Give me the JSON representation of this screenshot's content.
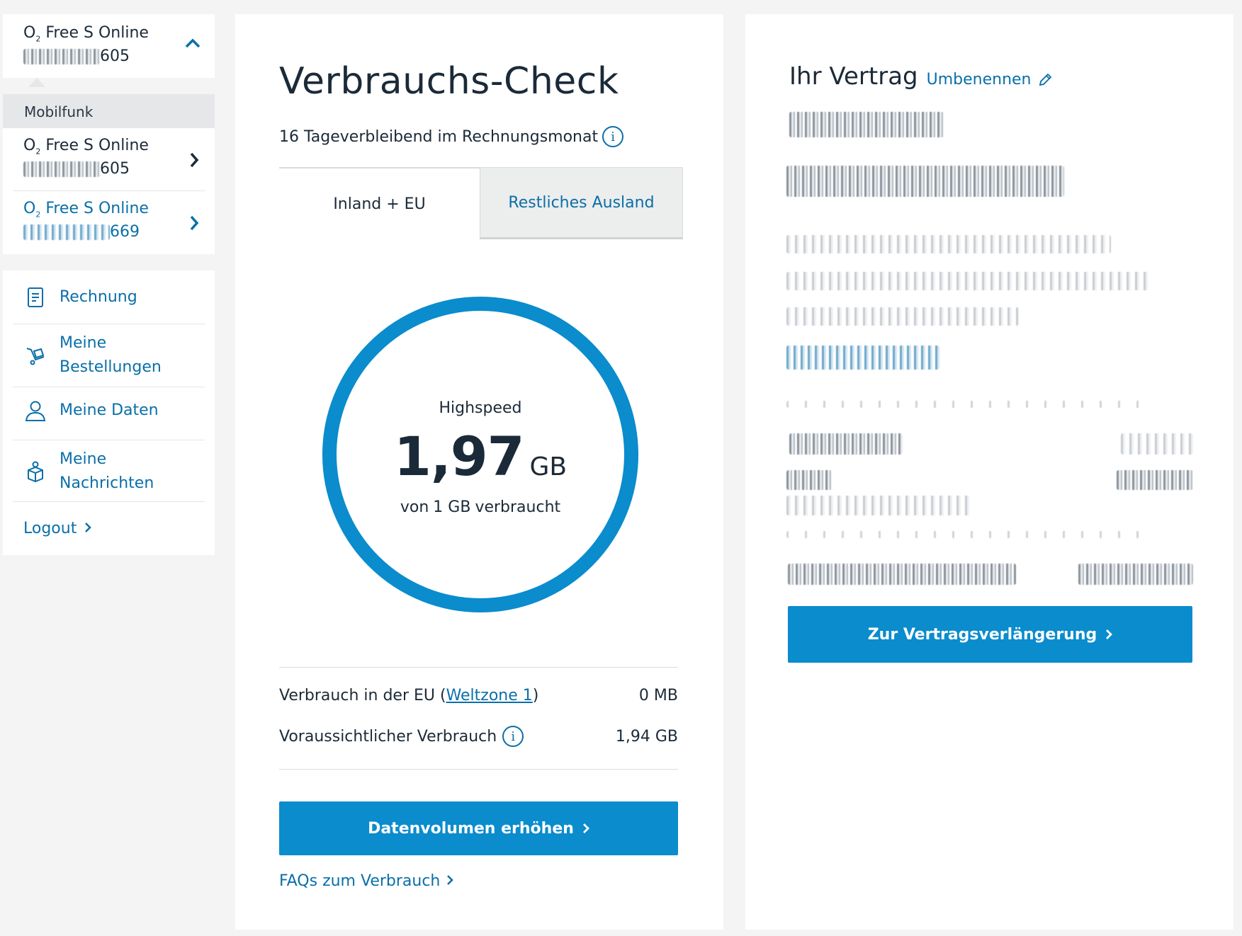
{
  "sidebar": {
    "current_contract": {
      "name_prefix": "O",
      "name_sub": "2",
      "name_rest": " Free S Online",
      "number_suffix": "605"
    },
    "group_label": "Mobilfunk",
    "contracts": [
      {
        "name_prefix": "O",
        "name_sub": "2",
        "name_rest": " Free S Online",
        "number_suffix": "605",
        "active": true
      },
      {
        "name_prefix": "O",
        "name_sub": "2",
        "name_rest": " Free S Online",
        "number_suffix": "669",
        "active": false
      }
    ],
    "menu": [
      {
        "label": "Rechnung",
        "icon": "invoice-icon"
      },
      {
        "label": "Meine\nBestellungen",
        "icon": "cart-icon"
      },
      {
        "label": "Meine Daten",
        "icon": "person-icon"
      },
      {
        "label": "Meine\nNachrichten",
        "icon": "mailbox-icon"
      }
    ],
    "logout": "Logout"
  },
  "main": {
    "title": "Verbrauchs-Check",
    "remaining_bold": "16 Tage",
    "remaining_text": " verbleibend im Rechnungsmonat",
    "tabs": [
      "Inland + EU",
      "Restliches Ausland"
    ],
    "gauge": {
      "label": "Highspeed",
      "value": "1,97",
      "unit": "GB",
      "sub_prefix": "von",
      "sub_amount": "1 GB",
      "sub_suffix": "verbraucht",
      "used_fraction": 1.0
    },
    "rows": [
      {
        "label_prefix": "Verbrauch in der EU (",
        "link": "Weltzone 1",
        "label_suffix": ")",
        "value": "0 MB"
      },
      {
        "label": "Voraussichtlicher Verbrauch",
        "value": "1,94 GB"
      }
    ],
    "button": "Datenvolumen erhöhen",
    "faq": "FAQs zum Verbrauch"
  },
  "contract": {
    "title": "Ihr Vertrag",
    "rename": "Umbenennen",
    "button": "Zur Vertragsverlängerung"
  },
  "colors": {
    "brand_blue": "#0a8ccd",
    "link_blue": "#0a6fa8",
    "text": "#1b2a38",
    "bg": "#f4f4f4"
  }
}
